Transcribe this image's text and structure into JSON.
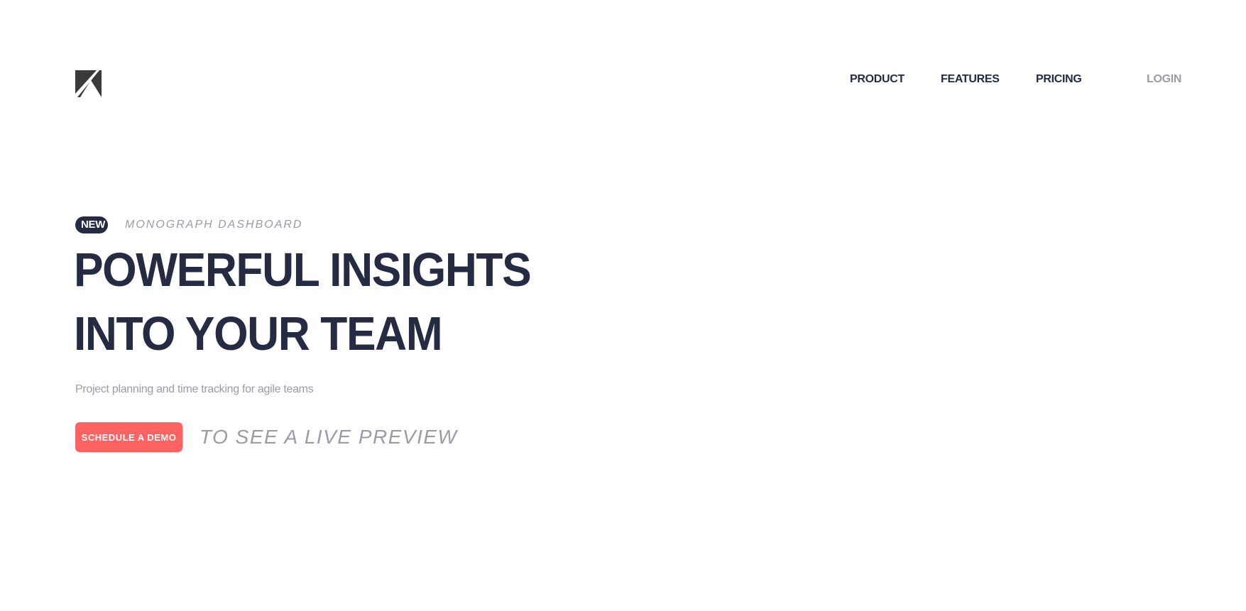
{
  "brand": {
    "logo_icon": "monograph-k-logo-icon",
    "primary_color": "#252b42"
  },
  "nav": {
    "items": [
      {
        "label": "PRODUCT"
      },
      {
        "label": "FEATURES"
      },
      {
        "label": "PRICING"
      }
    ],
    "login_label": "LOGIN",
    "login_color": "#9a9ba7"
  },
  "hero": {
    "badge": "NEW",
    "badge_caption": "MONOGRAPH DASHBOARD",
    "headline": "POWERFUL INSIGHTS INTO YOUR TEAM",
    "subtitle": "Project planning and time tracking for agile teams",
    "cta_label": "SCHEDULE A DEMO",
    "cta_color": "#ff6361",
    "cta_caption": "TO SEE A LIVE PREVIEW"
  }
}
